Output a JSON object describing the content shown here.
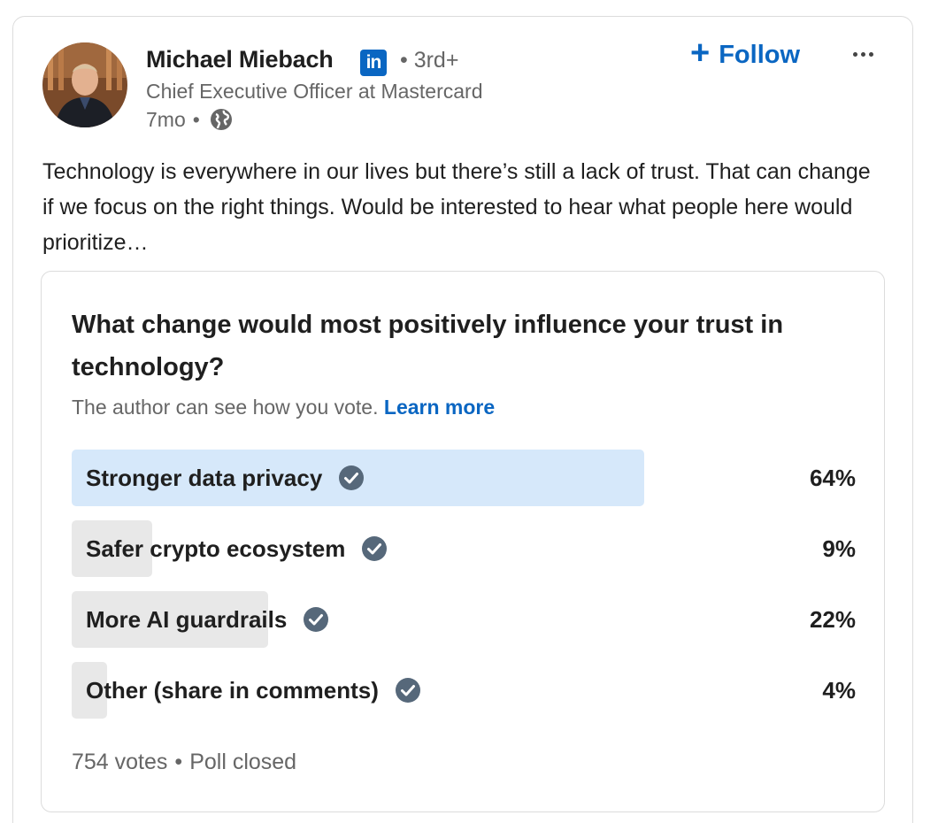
{
  "author": {
    "name": "Michael Miebach",
    "badge": "in",
    "degree": "• 3rd+",
    "headline": "Chief Executive Officer at Mastercard",
    "time": "7mo",
    "visibility_icon": "globe-icon"
  },
  "actions": {
    "follow_label": "Follow",
    "follow_icon": "+",
    "more_icon": "ellipsis-icon"
  },
  "post": {
    "text": "Technology is everywhere in our lives but there’s still a lack of trust. That can change if we focus on the right things. Would be interested to hear what people here would prioritize…"
  },
  "poll": {
    "question": "What change would most positively influence your trust in technology?",
    "note": "The author can see how you vote.",
    "learn_more": "Learn more",
    "options": [
      {
        "label": "Stronger data privacy",
        "percent": "64%",
        "value": 64,
        "selected": true
      },
      {
        "label": "Safer crypto ecosystem",
        "percent": "9%",
        "value": 9,
        "selected": false
      },
      {
        "label": "More AI guardrails",
        "percent": "22%",
        "value": 22,
        "selected": false
      },
      {
        "label": "Other (share in comments)",
        "percent": "4%",
        "value": 4,
        "selected": false
      }
    ],
    "votes": "754 votes",
    "status": "Poll closed"
  },
  "colors": {
    "brand_blue": "#0a66c2",
    "selected_bar": "#d6e8fa",
    "bar": "#e8e8e8",
    "check": "#56687a"
  }
}
